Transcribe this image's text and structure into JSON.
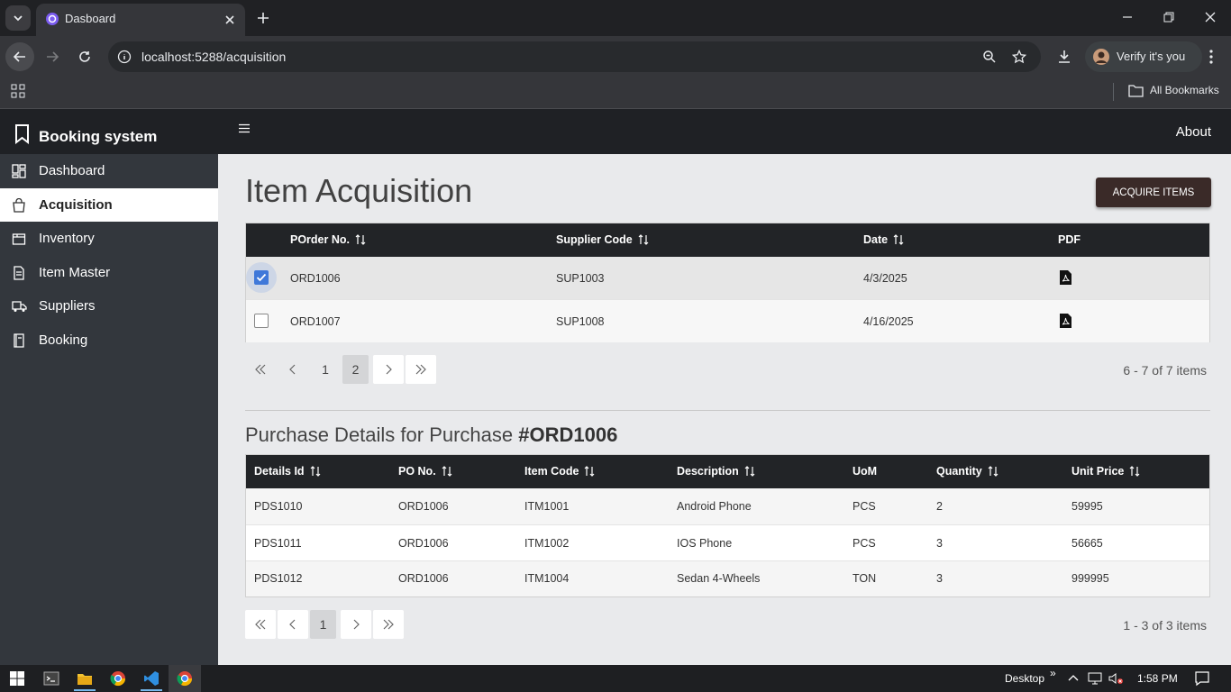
{
  "browser": {
    "tab_title": "Dasboard",
    "url": "localhost:5288/acquisition",
    "verify_label": "Verify it's you",
    "bookmarks_label": "All Bookmarks"
  },
  "app": {
    "brand": "Booking system",
    "about": "About",
    "nav": [
      {
        "label": "Dashboard",
        "icon": "dashboard-icon"
      },
      {
        "label": "Acquisition",
        "icon": "bag-icon",
        "active": true
      },
      {
        "label": "Inventory",
        "icon": "box-icon"
      },
      {
        "label": "Item Master",
        "icon": "document-icon"
      },
      {
        "label": "Suppliers",
        "icon": "truck-icon"
      },
      {
        "label": "Booking",
        "icon": "book-icon"
      }
    ]
  },
  "page": {
    "title": "Item Acquisition",
    "acquire_button": "ACQUIRE ITEMS"
  },
  "orders_grid": {
    "columns": [
      "POrder No.",
      "Supplier Code",
      "Date",
      "PDF"
    ],
    "rows": [
      {
        "checked": true,
        "porder": "ORD1006",
        "supplier": "SUP1003",
        "date": "4/3/2025"
      },
      {
        "checked": false,
        "porder": "ORD1007",
        "supplier": "SUP1008",
        "date": "4/16/2025"
      }
    ],
    "pages": [
      "1",
      "2"
    ],
    "current_page": "2",
    "pager_info": "6 - 7 of 7 items"
  },
  "details": {
    "title_prefix": "Purchase Details for Purchase",
    "title_id": "#ORD1006",
    "columns": [
      "Details Id",
      "PO No.",
      "Item Code",
      "Description",
      "UoM",
      "Quantity",
      "Unit Price"
    ],
    "rows": [
      {
        "details_id": "PDS1010",
        "po": "ORD1006",
        "item": "ITM1001",
        "desc": "Android Phone",
        "uom": "PCS",
        "qty": "2",
        "price": "59995"
      },
      {
        "details_id": "PDS1011",
        "po": "ORD1006",
        "item": "ITM1002",
        "desc": "IOS Phone",
        "uom": "PCS",
        "qty": "3",
        "price": "56665"
      },
      {
        "details_id": "PDS1012",
        "po": "ORD1006",
        "item": "ITM1004",
        "desc": "Sedan 4-Wheels",
        "uom": "TON",
        "qty": "3",
        "price": "999995"
      }
    ],
    "pages": [
      "1"
    ],
    "current_page": "1",
    "pager_info": "1 - 3 of 3 items"
  },
  "taskbar": {
    "desktop_label": "Desktop",
    "time": "1:58 PM"
  },
  "colors": {
    "accent_checkbox": "#3f78d9",
    "header_dark": "#222427",
    "sidebar": "#33373d",
    "acquire_button": "#3a2a28"
  }
}
